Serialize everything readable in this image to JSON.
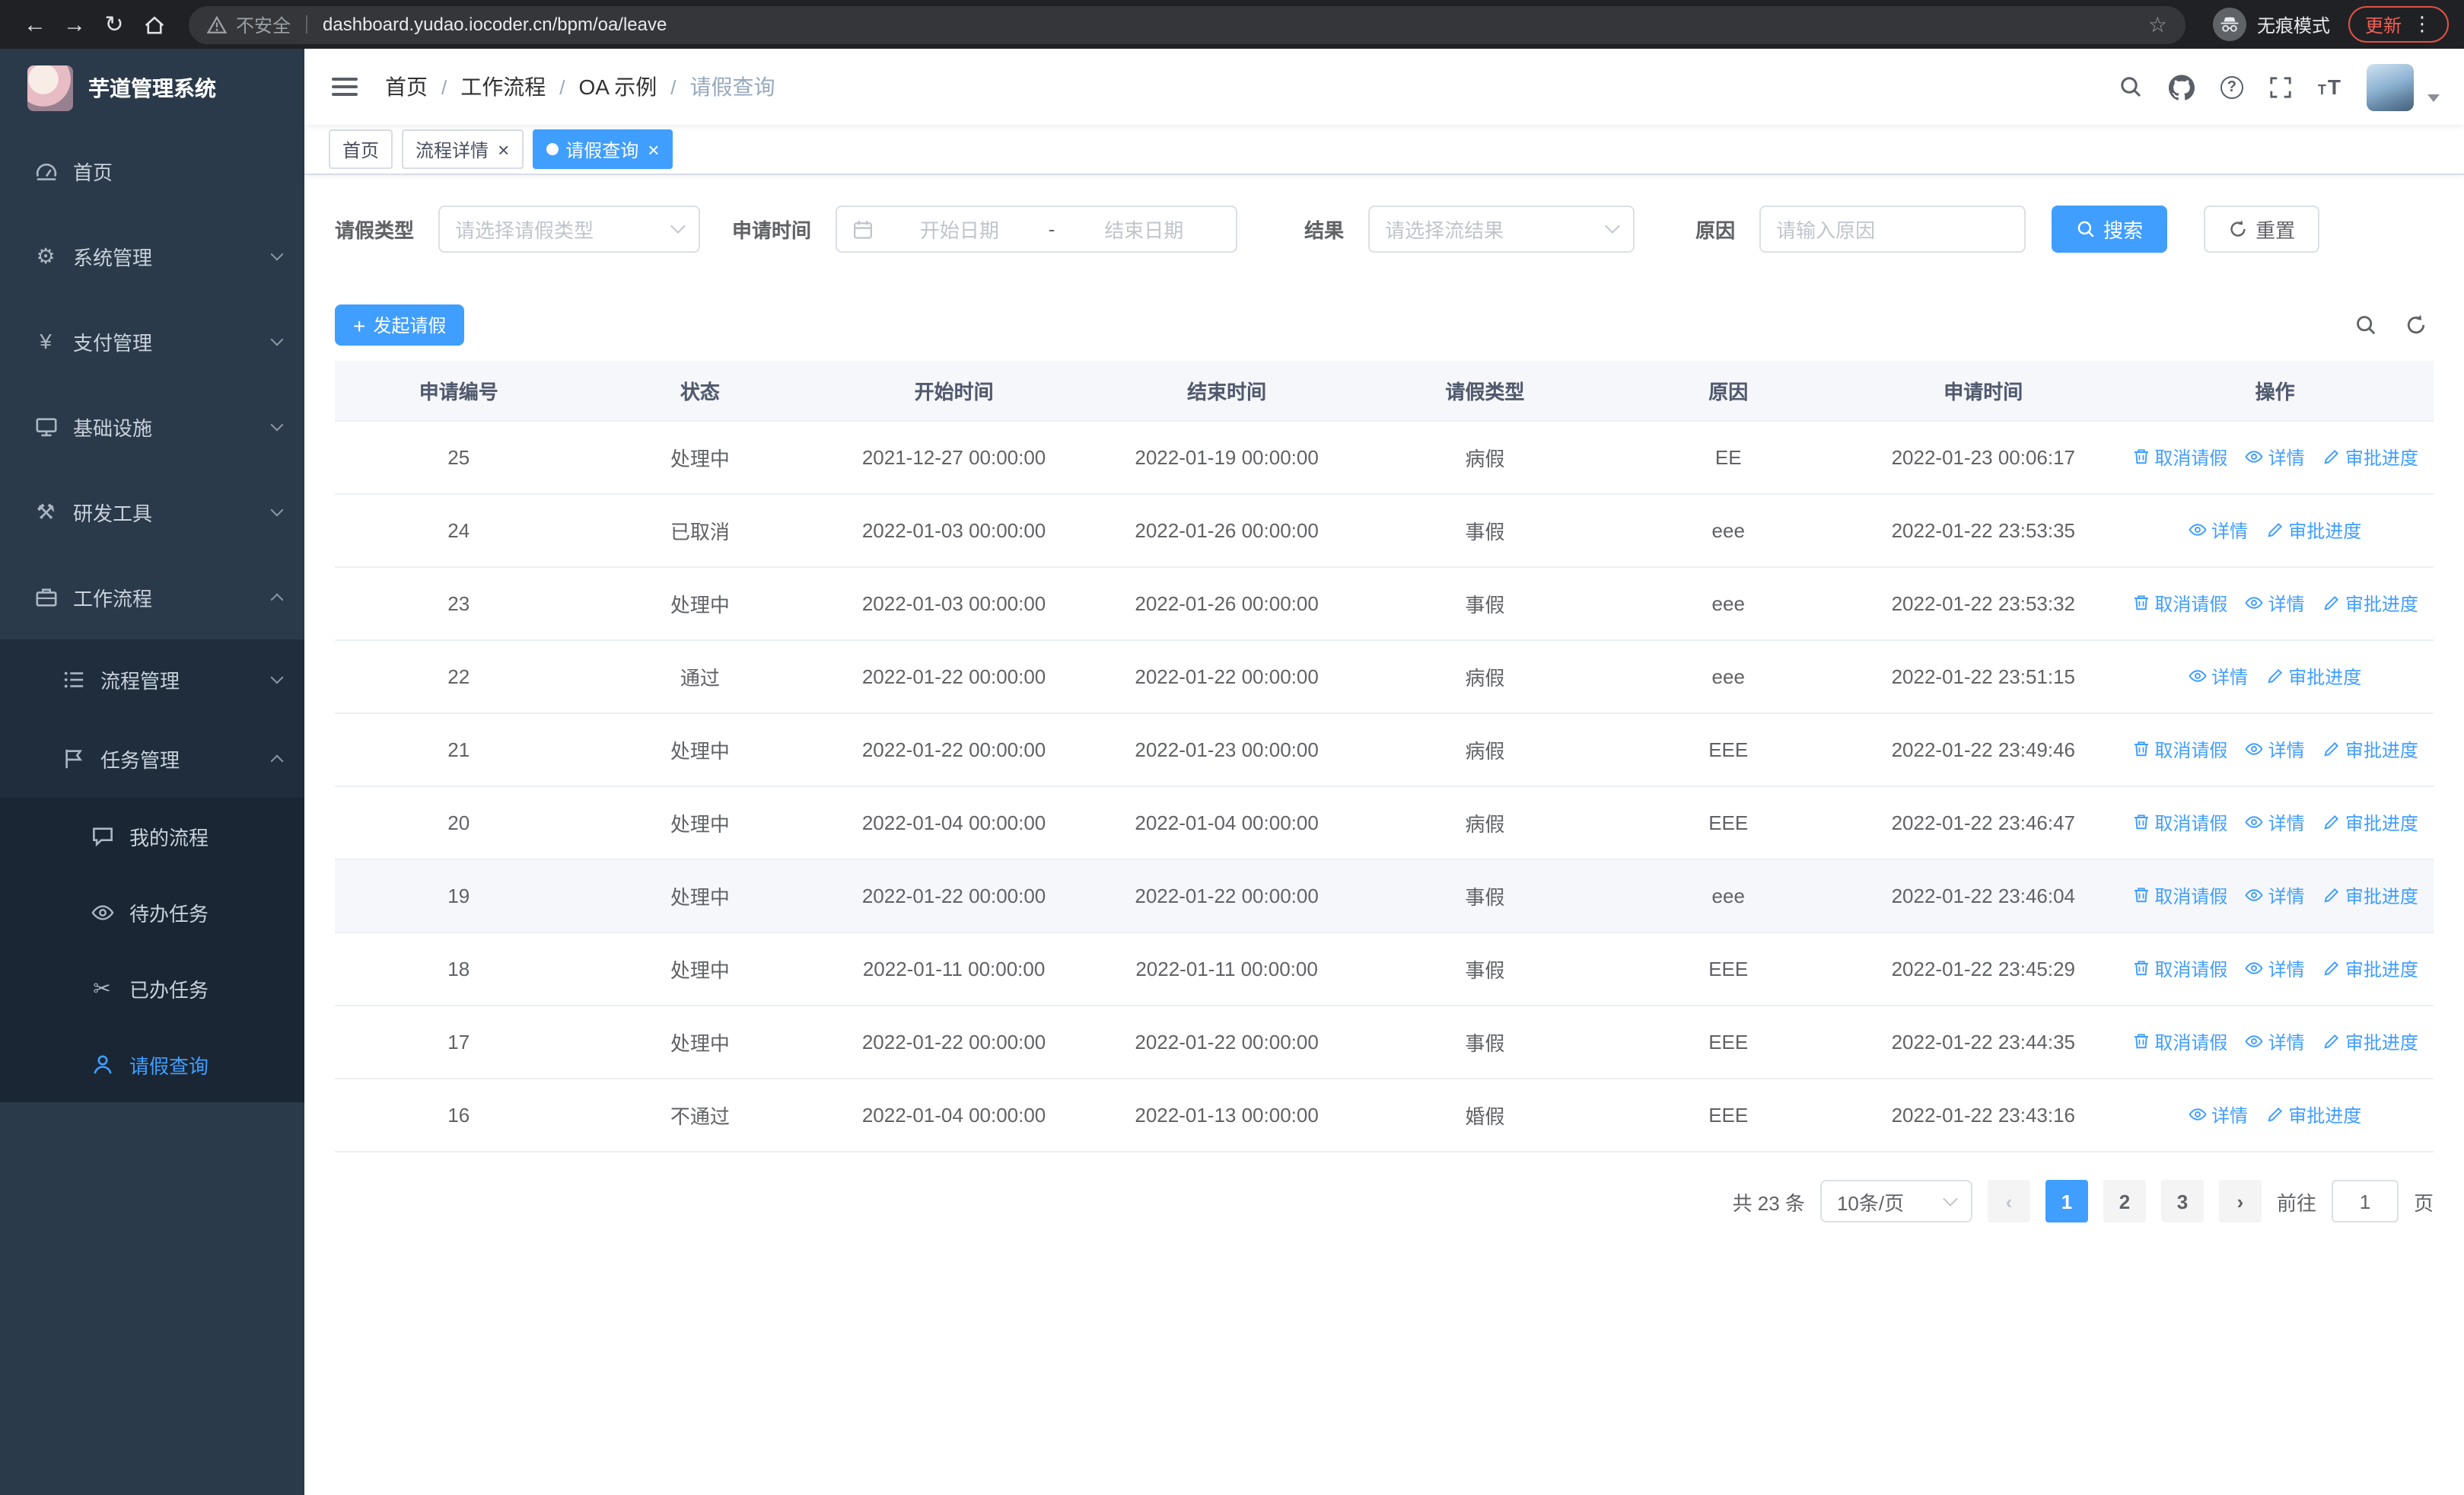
{
  "browser": {
    "security_label": "不安全",
    "url": "dashboard.yudao.iocoder.cn/bpm/oa/leave",
    "incognito_label": "无痕模式",
    "update_label": "更新"
  },
  "icons": {
    "back": "←",
    "forward": "→",
    "reload": "↻",
    "star": "☆",
    "menu_dots": "⋮",
    "gear": "⚙",
    "yen": "¥",
    "hammer": "⚒",
    "scissors": "✂",
    "plus": "+",
    "question": "?",
    "font_small": "T",
    "font_big": "T",
    "prev_arrow": "‹",
    "next_arrow": "›",
    "close": "×"
  },
  "sidebar": {
    "title": "芋道管理系统",
    "items": [
      "首页",
      "系统管理",
      "支付管理",
      "基础设施",
      "研发工具",
      "工作流程"
    ],
    "workflow_children": [
      "流程管理",
      "任务管理"
    ],
    "task_children": [
      "我的流程",
      "待办任务",
      "已办任务",
      "请假查询"
    ]
  },
  "navbar": {
    "breadcrumb": [
      "首页",
      "工作流程",
      "OA 示例",
      "请假查询"
    ]
  },
  "tabs": [
    "首页",
    "流程详情",
    "请假查询"
  ],
  "filters": {
    "leave_type_label": "请假类型",
    "leave_type_placeholder": "请选择请假类型",
    "apply_time_label": "申请时间",
    "start_date_placeholder": "开始日期",
    "range_separator": "-",
    "end_date_placeholder": "结束日期",
    "result_label": "结果",
    "result_placeholder": "请选择流结果",
    "reason_label": "原因",
    "reason_placeholder": "请输入原因",
    "search_button": "搜索",
    "reset_button": "重置"
  },
  "toolbar": {
    "create_button": "发起请假"
  },
  "table": {
    "headers": [
      "申请编号",
      "状态",
      "开始时间",
      "结束时间",
      "请假类型",
      "原因",
      "申请时间",
      "操作"
    ],
    "ops": {
      "cancel": "取消请假",
      "detail": "详情",
      "progress": "审批进度"
    },
    "rows": [
      {
        "id": "25",
        "status": "处理中",
        "start": "2021-12-27 00:00:00",
        "end": "2022-01-19 00:00:00",
        "type": "病假",
        "reason": "EE",
        "apply_time": "2022-01-23 00:06:17"
      },
      {
        "id": "24",
        "status": "已取消",
        "start": "2022-01-03 00:00:00",
        "end": "2022-01-26 00:00:00",
        "type": "事假",
        "reason": "eee",
        "apply_time": "2022-01-22 23:53:35"
      },
      {
        "id": "23",
        "status": "处理中",
        "start": "2022-01-03 00:00:00",
        "end": "2022-01-26 00:00:00",
        "type": "事假",
        "reason": "eee",
        "apply_time": "2022-01-22 23:53:32"
      },
      {
        "id": "22",
        "status": "通过",
        "start": "2022-01-22 00:00:00",
        "end": "2022-01-22 00:00:00",
        "type": "病假",
        "reason": "eee",
        "apply_time": "2022-01-22 23:51:15"
      },
      {
        "id": "21",
        "status": "处理中",
        "start": "2022-01-22 00:00:00",
        "end": "2022-01-23 00:00:00",
        "type": "病假",
        "reason": "EEE",
        "apply_time": "2022-01-22 23:49:46"
      },
      {
        "id": "20",
        "status": "处理中",
        "start": "2022-01-04 00:00:00",
        "end": "2022-01-04 00:00:00",
        "type": "病假",
        "reason": "EEE",
        "apply_time": "2022-01-22 23:46:47"
      },
      {
        "id": "19",
        "status": "处理中",
        "start": "2022-01-22 00:00:00",
        "end": "2022-01-22 00:00:00",
        "type": "事假",
        "reason": "eee",
        "apply_time": "2022-01-22 23:46:04"
      },
      {
        "id": "18",
        "status": "处理中",
        "start": "2022-01-11 00:00:00",
        "end": "2022-01-11 00:00:00",
        "type": "事假",
        "reason": "EEE",
        "apply_time": "2022-01-22 23:45:29"
      },
      {
        "id": "17",
        "status": "处理中",
        "start": "2022-01-22 00:00:00",
        "end": "2022-01-22 00:00:00",
        "type": "事假",
        "reason": "EEE",
        "apply_time": "2022-01-22 23:44:35"
      },
      {
        "id": "16",
        "status": "不通过",
        "start": "2022-01-04 00:00:00",
        "end": "2022-01-13 00:00:00",
        "type": "婚假",
        "reason": "EEE",
        "apply_time": "2022-01-22 23:43:16"
      }
    ]
  },
  "pagination": {
    "total": "共 23 条",
    "page_size": "10条/页",
    "page1": "1",
    "page2": "2",
    "page3": "3",
    "goto_label": "前往",
    "goto_value": "1",
    "page_unit": "页"
  },
  "colors": {
    "primary": "#409eff",
    "sidebar_bg": "#2b3a4a",
    "sidebar_submenu_bg": "#1f2d3d",
    "chrome_bg": "#202124",
    "update_red": "#f06055"
  }
}
